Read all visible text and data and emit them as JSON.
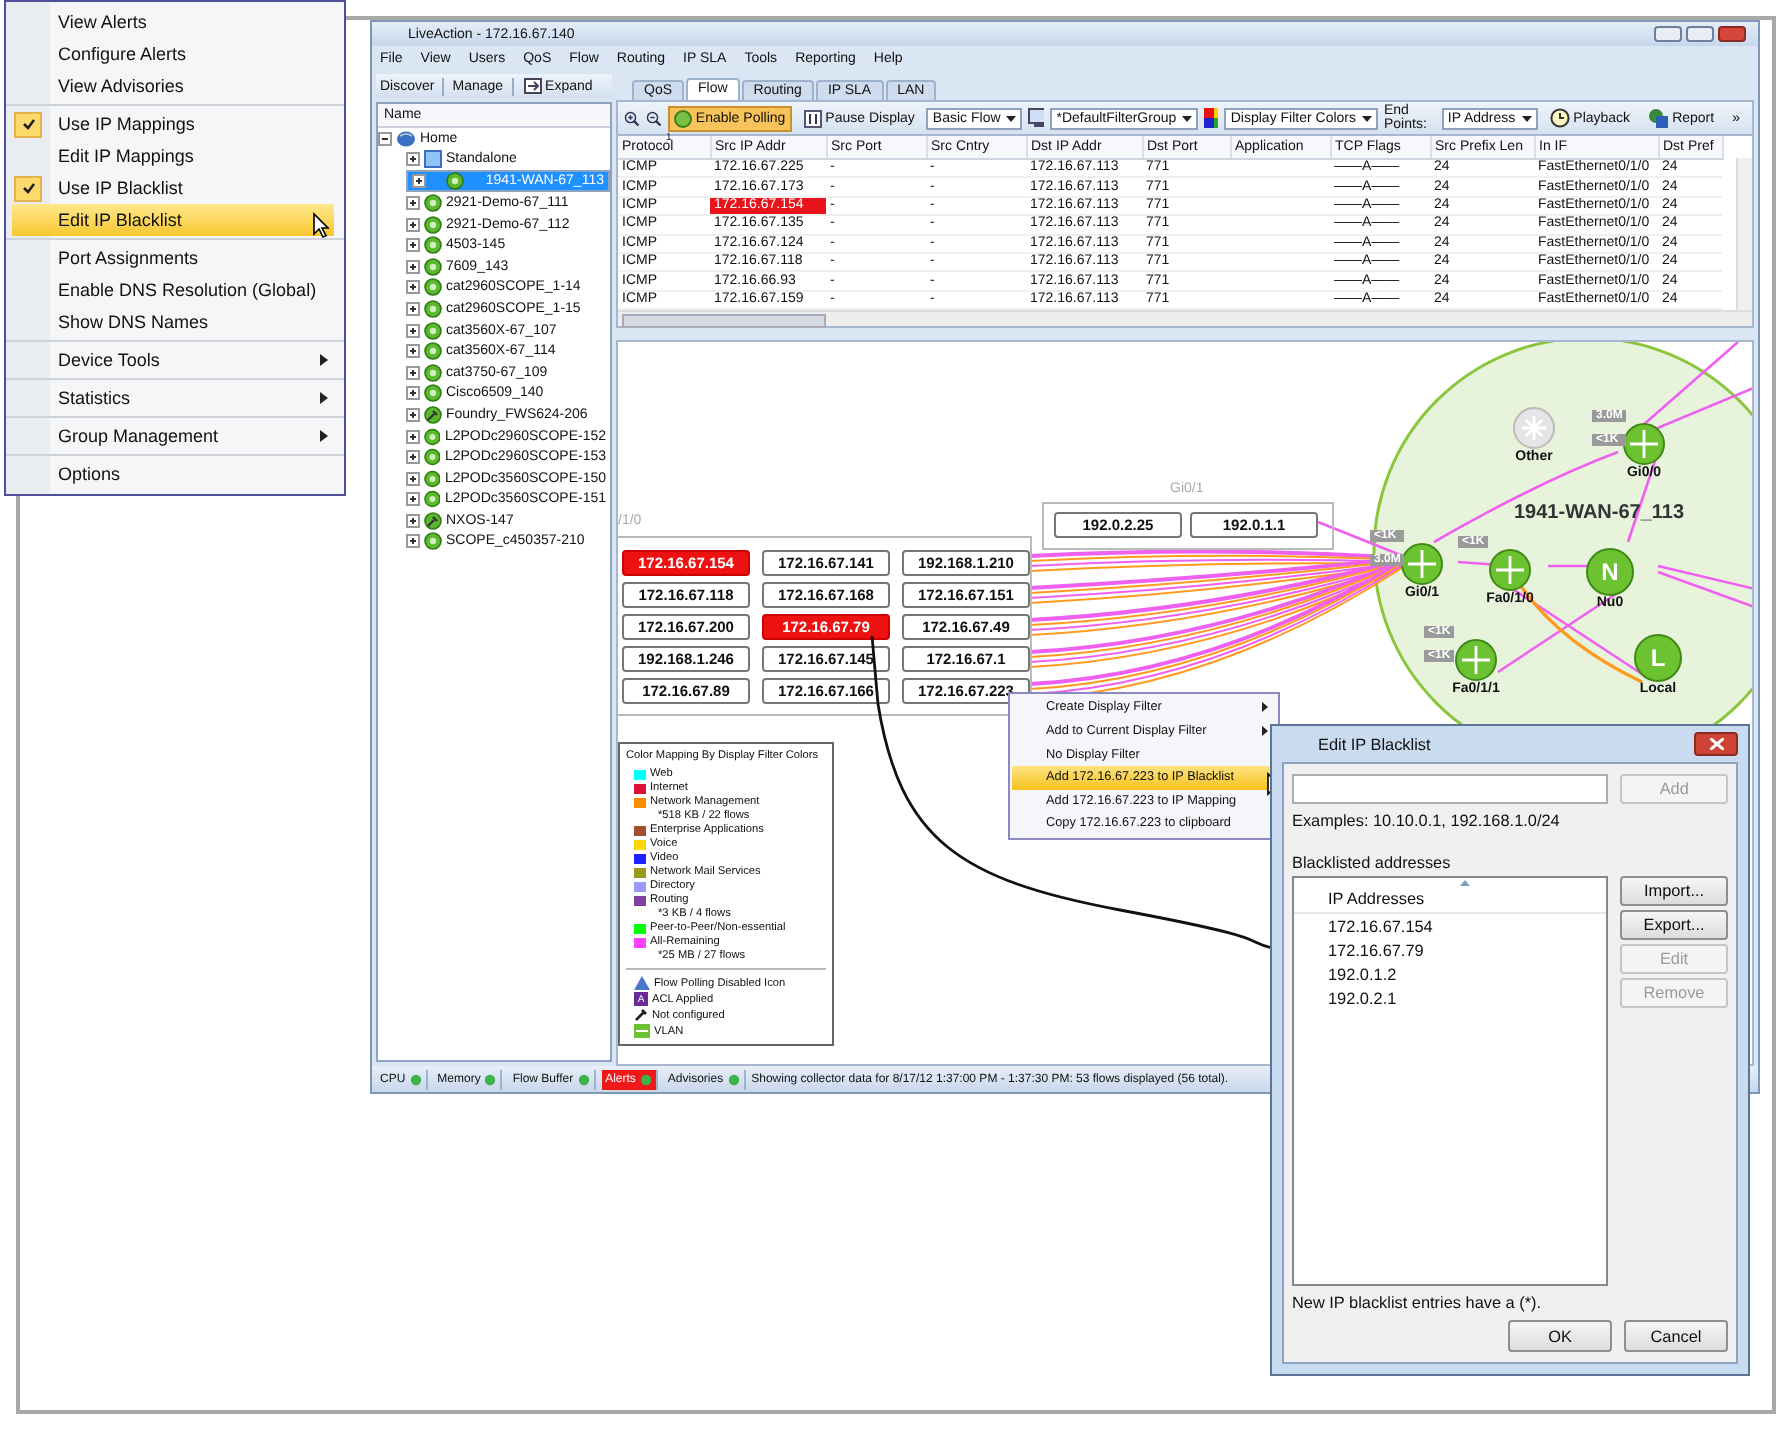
{
  "context_menu_app": {
    "groups": [
      {
        "items": [
          {
            "label": "View Alerts",
            "kind": "plain",
            "checked": false,
            "selected": false
          },
          {
            "label": "Configure Alerts",
            "kind": "plain",
            "checked": false,
            "selected": false
          },
          {
            "label": "View Advisories",
            "kind": "plain",
            "checked": false,
            "selected": false
          }
        ]
      },
      {
        "items": [
          {
            "label": "Use IP Mappings",
            "kind": "check",
            "checked": true,
            "selected": false
          },
          {
            "label": "Edit IP Mappings",
            "kind": "plain",
            "checked": false,
            "selected": false
          },
          {
            "label": "Use IP Blacklist",
            "kind": "check",
            "checked": true,
            "selected": false
          },
          {
            "label": "Edit IP Blacklist",
            "kind": "plain",
            "checked": false,
            "selected": true
          }
        ]
      },
      {
        "items": [
          {
            "label": "Port Assignments",
            "kind": "plain",
            "checked": false,
            "selected": false
          },
          {
            "label": "Enable DNS Resolution (Global)",
            "kind": "plain",
            "checked": false,
            "selected": false
          },
          {
            "label": "Show DNS Names",
            "kind": "plain",
            "checked": false,
            "selected": false
          }
        ]
      },
      {
        "items": [
          {
            "label": "Device Tools",
            "kind": "submenu",
            "checked": false,
            "selected": false
          }
        ]
      },
      {
        "items": [
          {
            "label": "Statistics",
            "kind": "submenu",
            "checked": false,
            "selected": false
          }
        ]
      },
      {
        "items": [
          {
            "label": "Group Management",
            "kind": "submenu",
            "checked": false,
            "selected": false
          }
        ]
      },
      {
        "items": [
          {
            "label": "Options",
            "kind": "plain",
            "checked": false,
            "selected": false
          }
        ]
      }
    ]
  },
  "window": {
    "title": "LiveAction - 172.16.67.140"
  },
  "menu_bar": [
    "File",
    "View",
    "Users",
    "QoS",
    "Flow",
    "Routing",
    "IP SLA",
    "Tools",
    "Reporting",
    "Help"
  ],
  "left_toolbar": [
    "Discover",
    "Manage",
    "Expand"
  ],
  "tree": {
    "header": "Name",
    "items": [
      {
        "label": "Home",
        "kind": "home",
        "expanded": true,
        "selected": false,
        "children": [
          {
            "label": "Standalone",
            "kind": "standalone",
            "expanded": false,
            "selected": false
          },
          {
            "label": "1941-WAN-67_113",
            "kind": "router",
            "expanded": false,
            "selected": true
          },
          {
            "label": "2921-Demo-67_111",
            "kind": "router",
            "expanded": false,
            "selected": false
          },
          {
            "label": "2921-Demo-67_112",
            "kind": "router",
            "expanded": false,
            "selected": false
          },
          {
            "label": "4503-145",
            "kind": "router",
            "expanded": false,
            "selected": false
          },
          {
            "label": "7609_143",
            "kind": "router",
            "expanded": false,
            "selected": false
          },
          {
            "label": "cat2960SCOPE_1-14",
            "kind": "router",
            "expanded": false,
            "selected": false
          },
          {
            "label": "cat2960SCOPE_1-15",
            "kind": "router",
            "expanded": false,
            "selected": false
          },
          {
            "label": "cat3560X-67_107",
            "kind": "router",
            "expanded": false,
            "selected": false
          },
          {
            "label": "cat3560X-67_114",
            "kind": "router",
            "expanded": false,
            "selected": false
          },
          {
            "label": "cat3750-67_109",
            "kind": "router",
            "expanded": false,
            "selected": false
          },
          {
            "label": "Cisco6509_140",
            "kind": "router",
            "expanded": false,
            "selected": false
          },
          {
            "label": "Foundry_FWS624-206",
            "kind": "unconfigured",
            "expanded": false,
            "selected": false
          },
          {
            "label": "L2PODc2960SCOPE-152",
            "kind": "router",
            "expanded": false,
            "selected": false
          },
          {
            "label": "L2PODc2960SCOPE-153",
            "kind": "router",
            "expanded": false,
            "selected": false
          },
          {
            "label": "L2PODc3560SCOPE-150",
            "kind": "router",
            "expanded": false,
            "selected": false
          },
          {
            "label": "L2PODc3560SCOPE-151",
            "kind": "router",
            "expanded": false,
            "selected": false
          },
          {
            "label": "NXOS-147",
            "kind": "unconfigured",
            "expanded": false,
            "selected": false
          },
          {
            "label": "SCOPE_c450357-210",
            "kind": "router",
            "expanded": false,
            "selected": false
          }
        ]
      }
    ]
  },
  "tabs": [
    {
      "label": "QoS",
      "selected": false
    },
    {
      "label": "Flow",
      "selected": true
    },
    {
      "label": "Routing",
      "selected": false
    },
    {
      "label": "IP SLA",
      "selected": false
    },
    {
      "label": "LAN",
      "selected": false
    }
  ],
  "toolbar": [
    {
      "kind": "zoom-in"
    },
    {
      "kind": "zoom-out"
    },
    {
      "kind": "toggle",
      "label": "Enable Polling",
      "on": true
    },
    {
      "kind": "pause",
      "label": "Pause Display"
    },
    {
      "kind": "select",
      "value": "Basic Flow"
    },
    {
      "kind": "filter-icon"
    },
    {
      "kind": "select",
      "value": "*DefaultFilterGroup"
    },
    {
      "kind": "colors-icon"
    },
    {
      "kind": "select",
      "value": "Display Filter Colors"
    },
    {
      "kind": "label",
      "label": "End Points:"
    },
    {
      "kind": "select",
      "value": "IP Address"
    },
    {
      "kind": "playback",
      "label": "Playback"
    },
    {
      "kind": "report",
      "label": "Report"
    },
    {
      "kind": "overflow",
      "label": "»"
    }
  ],
  "table": {
    "sort_order": "1",
    "columns": [
      "Protocol",
      "Src IP Addr",
      "Src Port",
      "Src Cntry",
      "Dst IP Addr",
      "Dst Port",
      "Application",
      "TCP Flags",
      "Src Prefix Len",
      "In IF",
      "Dst Pref"
    ],
    "rows": [
      {
        "src_flagged": false,
        "cells": [
          "ICMP",
          "172.16.67.225",
          "-",
          "-",
          "172.16.67.113",
          "771",
          "",
          "——A——",
          "24",
          "FastEthernet0/1/0",
          "24"
        ]
      },
      {
        "src_flagged": false,
        "cells": [
          "ICMP",
          "172.16.67.173",
          "-",
          "-",
          "172.16.67.113",
          "771",
          "",
          "——A——",
          "24",
          "FastEthernet0/1/0",
          "24"
        ]
      },
      {
        "src_flagged": true,
        "cells": [
          "ICMP",
          "172.16.67.154",
          "-",
          "-",
          "172.16.67.113",
          "771",
          "",
          "——A——",
          "24",
          "FastEthernet0/1/0",
          "24"
        ]
      },
      {
        "src_flagged": false,
        "cells": [
          "ICMP",
          "172.16.67.135",
          "-",
          "-",
          "172.16.67.113",
          "771",
          "",
          "——A——",
          "24",
          "FastEthernet0/1/0",
          "24"
        ]
      },
      {
        "src_flagged": false,
        "cells": [
          "ICMP",
          "172.16.67.124",
          "-",
          "-",
          "172.16.67.113",
          "771",
          "",
          "——A——",
          "24",
          "FastEthernet0/1/0",
          "24"
        ]
      },
      {
        "src_flagged": false,
        "cells": [
          "ICMP",
          "172.16.67.118",
          "-",
          "-",
          "172.16.67.113",
          "771",
          "",
          "——A——",
          "24",
          "FastEthernet0/1/0",
          "24"
        ]
      },
      {
        "src_flagged": false,
        "cells": [
          "ICMP",
          "172.16.66.93",
          "-",
          "-",
          "172.16.67.113",
          "771",
          "",
          "——A——",
          "24",
          "FastEthernet0/1/0",
          "24"
        ]
      },
      {
        "src_flagged": false,
        "cells": [
          "ICMP",
          "172.16.67.159",
          "-",
          "-",
          "172.16.67.113",
          "771",
          "",
          "——A——",
          "24",
          "FastEthernet0/1/0",
          "24"
        ]
      }
    ]
  },
  "map": {
    "left_group_label": "/1/0",
    "gi_group_label": "Gi0/1",
    "ip_nodes": [
      {
        "label": "172.16.67.154",
        "flagged": true
      },
      {
        "label": "172.16.67.141",
        "flagged": false
      },
      {
        "label": "192.168.1.210",
        "flagged": false
      },
      {
        "label": "172.16.67.118",
        "flagged": false
      },
      {
        "label": "172.16.67.168",
        "flagged": false
      },
      {
        "label": "172.16.67.151",
        "flagged": false
      },
      {
        "label": "172.16.67.200",
        "flagged": false
      },
      {
        "label": "172.16.67.79",
        "flagged": true
      },
      {
        "label": "172.16.67.49",
        "flagged": false
      },
      {
        "label": "192.168.1.246",
        "flagged": false
      },
      {
        "label": "172.16.67.145",
        "flagged": false
      },
      {
        "label": "172.16.67.1",
        "flagged": false
      },
      {
        "label": "172.16.67.89",
        "flagged": false
      },
      {
        "label": "172.16.67.166",
        "flagged": false
      },
      {
        "label": "172.16.67.223",
        "flagged": false
      }
    ],
    "gi_nodes": [
      {
        "label": "192.0.2.25"
      },
      {
        "label": "192.0.1.1"
      }
    ],
    "router_label": "1941-WAN-67_113",
    "interfaces": [
      {
        "label": "Other",
        "kind": "other"
      },
      {
        "label": "Gi0/0",
        "kind": "interface",
        "badges": [
          "3.0M",
          "<1K"
        ]
      },
      {
        "label": "Gi0/1",
        "kind": "interface",
        "badges": [
          "<1K",
          "3.0M"
        ]
      },
      {
        "label": "Fa0/1/0",
        "kind": "interface",
        "badges": [
          "<1K"
        ]
      },
      {
        "label": "Nu0",
        "kind": "letter",
        "glyph": "N"
      },
      {
        "label": "Fa0/1/1",
        "kind": "interface",
        "badges": [
          "<1K",
          "<1K"
        ]
      },
      {
        "label": "Local",
        "kind": "letter",
        "glyph": "L"
      }
    ],
    "legend": {
      "title": "Color Mapping By Display Filter Colors",
      "entries": [
        {
          "label": "Web",
          "color": "#00ffff"
        },
        {
          "label": "Internet",
          "color": "#e0103a"
        },
        {
          "label": "Network Management",
          "color": "#ff8c00",
          "note": "*518 KB / 22 flows"
        },
        {
          "label": "Enterprise Applications",
          "color": "#a0522d"
        },
        {
          "label": "Voice",
          "color": "#ffd700"
        },
        {
          "label": "Video",
          "color": "#2020ff"
        },
        {
          "label": "Network Mail Services",
          "color": "#9a9a20"
        },
        {
          "label": "Directory",
          "color": "#9999ff"
        },
        {
          "label": "Routing",
          "color": "#8040a0",
          "note": "*3 KB / 4 flows"
        },
        {
          "label": "Peer-to-Peer/Non-essential",
          "color": "#00ff00"
        },
        {
          "label": "All-Remaining",
          "color": "#ff40ff",
          "note": "*25 MB / 27 flows"
        }
      ],
      "icons": [
        {
          "kind": "polling-disabled",
          "label": "Flow Polling Disabled Icon"
        },
        {
          "kind": "acl",
          "glyph": "A",
          "label": "ACL Applied"
        },
        {
          "kind": "unconfigured",
          "label": "Not configured"
        },
        {
          "kind": "vlan",
          "label": "VLAN"
        }
      ]
    },
    "context_menu": [
      {
        "label": "Create Display Filter",
        "kind": "submenu",
        "selected": false
      },
      {
        "label": "Add to Current Display Filter",
        "kind": "submenu",
        "selected": false
      },
      {
        "label": "No Display Filter",
        "kind": "plain",
        "selected": false
      },
      {
        "label": "Add 172.16.67.223 to IP Blacklist",
        "kind": "plain",
        "selected": true
      },
      {
        "label": "Add 172.16.67.223 to IP Mapping",
        "kind": "plain",
        "selected": false
      },
      {
        "label": "Copy 172.16.67.223 to clipboard",
        "kind": "plain",
        "selected": false
      }
    ]
  },
  "status_bar": {
    "indicators": [
      {
        "label": "CPU",
        "alert": false
      },
      {
        "label": "Memory",
        "alert": false
      },
      {
        "label": "Flow Buffer",
        "alert": false
      },
      {
        "label": "Alerts",
        "alert": true
      },
      {
        "label": "Advisories",
        "alert": false
      }
    ],
    "message": "Showing collector data for 8/17/12 1:37:00 PM - 1:37:30 PM:  53 flows displayed (56 total)."
  },
  "dialog": {
    "title": "Edit IP Blacklist",
    "add_button": {
      "label": "Add",
      "disabled": true
    },
    "examples": "Examples: 10.10.0.1, 192.168.1.0/24",
    "list_label": "Blacklisted addresses",
    "list_header": "IP Addresses",
    "addresses": [
      "172.16.67.154",
      "172.16.67.79",
      "192.0.1.2",
      "192.0.2.1"
    ],
    "side_buttons": [
      {
        "label": "Import...",
        "disabled": false
      },
      {
        "label": "Export...",
        "disabled": false
      },
      {
        "label": "Edit",
        "disabled": true
      },
      {
        "label": "Remove",
        "disabled": true
      }
    ],
    "note": "New IP blacklist entries have a (*).",
    "buttons": [
      "OK",
      "Cancel"
    ]
  }
}
